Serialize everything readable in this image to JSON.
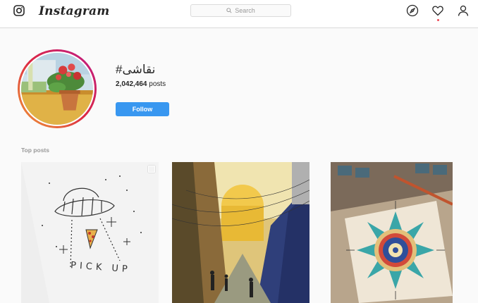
{
  "header": {
    "brand": "Instagram",
    "search_placeholder": "Search",
    "icons": [
      "instagram-glyph-icon",
      "compass-icon",
      "heart-icon",
      "profile-icon"
    ]
  },
  "hashtag": {
    "title": "#نقاشی",
    "post_count": "2,042,464",
    "post_count_suffix": "posts",
    "follow_label": "Follow"
  },
  "top_posts": {
    "title": "Top posts",
    "items": [
      {
        "caption": "PICK UP"
      },
      {
        "caption": ""
      },
      {
        "caption": ""
      }
    ]
  },
  "colors": {
    "accent": "#3897f0",
    "notification": "#ed4956",
    "ring_start": "#f09433",
    "ring_end": "#bc1888"
  }
}
